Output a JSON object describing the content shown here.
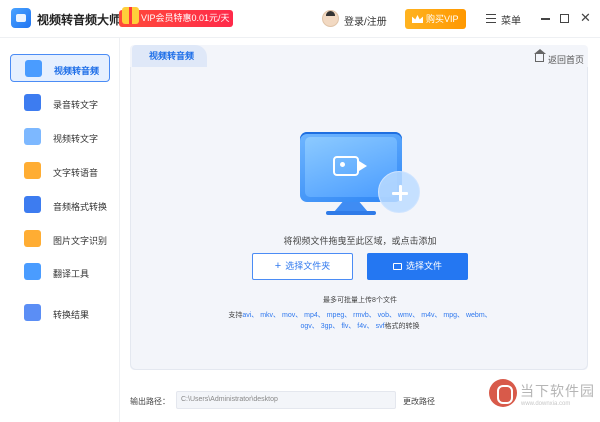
{
  "header": {
    "app_title": "视频转音频大师",
    "promo_text": "VIP会员特惠0.01元/天",
    "login_label": "登录/注册",
    "vip_label": "购买VIP",
    "menu_label": "菜单",
    "close_glyph": "✕"
  },
  "sidebar": {
    "items": [
      {
        "label": "视频转音频",
        "icon": "video-audio-icon",
        "active": true
      },
      {
        "label": "录音转文字",
        "icon": "recording-text-icon"
      },
      {
        "label": "视频转文字",
        "icon": "video-text-icon"
      },
      {
        "label": "文字转语音",
        "icon": "text-speech-icon"
      },
      {
        "label": "音频格式转换",
        "icon": "audio-format-icon"
      },
      {
        "label": "图片文字识别",
        "icon": "image-ocr-icon"
      },
      {
        "label": "翻译工具",
        "icon": "translate-icon"
      },
      {
        "label": "转换结果",
        "icon": "result-icon"
      }
    ]
  },
  "main": {
    "tab_label": "视频转音频",
    "back_label": "返回首页",
    "drag_hint": "将视频文件拖曳至此区域，或点击添加",
    "select_folder_label": "选择文件夹",
    "select_file_label": "选择文件",
    "plus_glyph": "+",
    "batch_limit": "最多可批量上传8个文件",
    "formats_prefix": "支持",
    "formats_line1": "avi、 mkv、 mov、 mp4、 mpeg、 rmvb、 vob、 wmv、 m4v、 mpg、 webm、",
    "formats_line2": "ogv、 3gp、 flv、 f4v、 svf",
    "formats_suffix": "格式的转换"
  },
  "output": {
    "label": "输出路径：",
    "path": "C:\\Users\\Administrator\\desktop",
    "change_label": "更改路径"
  },
  "watermark": {
    "text": "当下软件园",
    "sub": "www.downxia.com"
  },
  "colors": {
    "accent": "#2477f2",
    "promo": "#ff3b3b",
    "vip": "#ffa512"
  }
}
